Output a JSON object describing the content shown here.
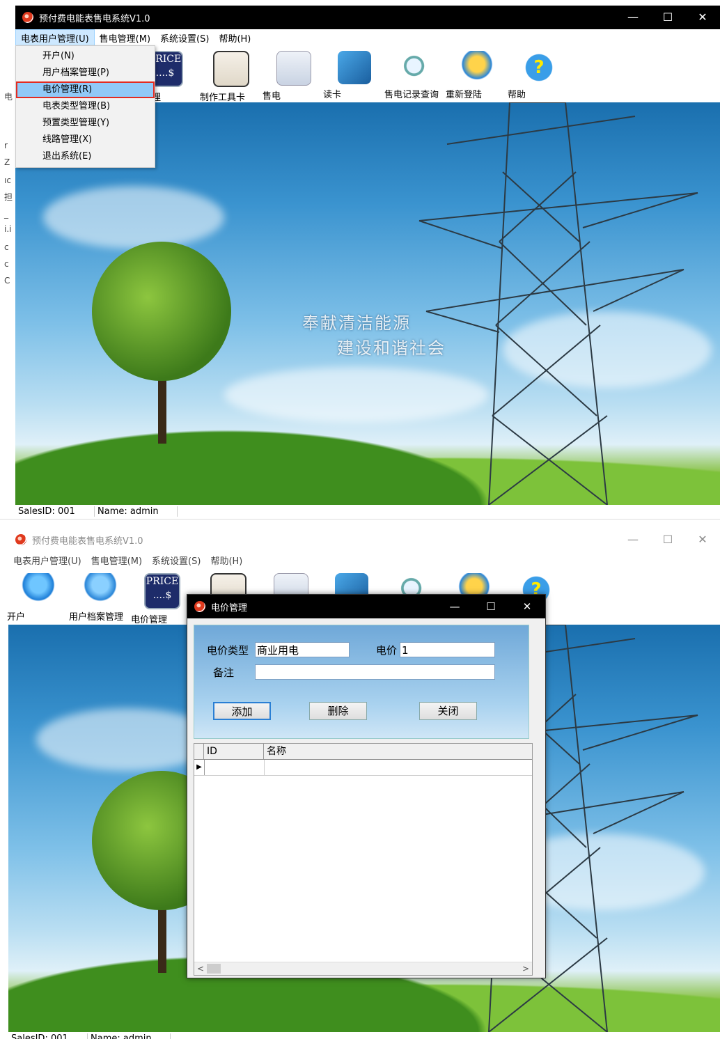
{
  "app": {
    "title": "预付费电能表售电系统V1.0"
  },
  "window_controls": {
    "minimize": "—",
    "maximize": "☐",
    "close": "✕"
  },
  "menu": [
    {
      "label": "电表用户管理(U)"
    },
    {
      "label": "售电管理(M)"
    },
    {
      "label": "系统设置(S)"
    },
    {
      "label": "帮助(H)"
    }
  ],
  "toolbar": {
    "items": [
      {
        "label": "开户",
        "icon": "open-account-icon"
      },
      {
        "label": "用户档案管理",
        "icon": "user-archive-icon"
      },
      {
        "label": "电价管理",
        "icon": "price-icon",
        "icon_text": "PRICE",
        "icon_text2": "....$"
      },
      {
        "label": "制作工具卡",
        "icon": "tool-card-icon"
      },
      {
        "label": "售电",
        "icon": "sell-electricity-icon"
      },
      {
        "label": "读卡",
        "icon": "read-card-icon"
      },
      {
        "label": "售电记录查询",
        "icon": "record-query-icon"
      },
      {
        "label": "重新登陆",
        "icon": "relogin-icon"
      },
      {
        "label": "帮助",
        "icon": "help-icon",
        "icon_text": "?"
      }
    ],
    "price_partial_label": "介管理"
  },
  "dropdown": {
    "items": [
      {
        "label": "开户(N)"
      },
      {
        "label": "用户档案管理(P)"
      },
      {
        "label": "电价管理(R)",
        "highlighted": true
      },
      {
        "label": "电表类型管理(B)"
      },
      {
        "label": "预置类型管理(Y)"
      },
      {
        "label": "线路管理(X)"
      },
      {
        "label": "退出系统(E)"
      }
    ]
  },
  "left_strip_chars": [
    "电",
    "r",
    "Z",
    "ıc",
    "担",
    "_",
    "i.i",
    "c",
    "c",
    "C"
  ],
  "slogan": {
    "line1": "奉献清洁能源",
    "line2": "建设和谐社会"
  },
  "status": {
    "sales_id": "SalesID:  001",
    "name": "Name:  admin"
  },
  "dialog": {
    "title": "电价管理",
    "price_type_label": "电价类型",
    "price_type_value": "商业用电",
    "price_label": "电价",
    "price_value": "1",
    "remark_label": "备注",
    "remark_value": "",
    "add_button": "添加",
    "delete_button": "删除",
    "close_button": "关闭",
    "grid": {
      "columns": [
        "ID",
        "名称"
      ],
      "row_indicator": "▶"
    },
    "scroll_left": "<",
    "scroll_right": ">"
  },
  "colors": {
    "title_bar": "#000000",
    "menu_highlight": "#91c9f7",
    "highlight_border": "#e32b21"
  }
}
